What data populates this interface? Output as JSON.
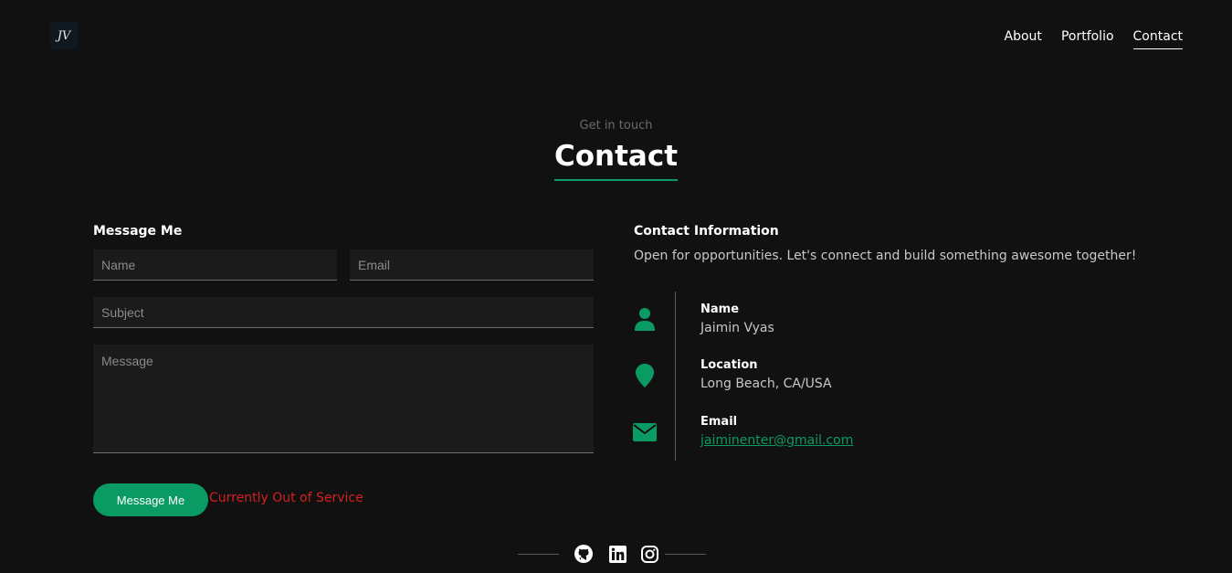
{
  "header": {
    "logo_text": "JV",
    "nav": [
      {
        "label": "About"
      },
      {
        "label": "Portfolio"
      },
      {
        "label": "Contact",
        "active": true
      }
    ]
  },
  "hero": {
    "eyebrow": "Get in touch",
    "title": "Contact"
  },
  "form": {
    "heading": "Message Me",
    "name_placeholder": "Name",
    "email_placeholder": "Email",
    "subject_placeholder": "Subject",
    "message_placeholder": "Message",
    "submit_label": "Message Me",
    "status_text": "Currently Out of Service"
  },
  "info": {
    "heading": "Contact Information",
    "description": "Open for opportunities. Let's connect and build something awesome together!",
    "items": [
      {
        "icon": "user-icon",
        "label": "Name",
        "value": "Jaimin Vyas"
      },
      {
        "icon": "location-pin-icon",
        "label": "Location",
        "value": "Long Beach, CA/USA"
      },
      {
        "icon": "envelope-icon",
        "label": "Email",
        "value": "jaiminenter@gmail.com"
      }
    ]
  },
  "social": [
    {
      "icon": "github-icon"
    },
    {
      "icon": "linkedin-icon"
    },
    {
      "icon": "instagram-icon"
    }
  ],
  "colors": {
    "background": "#111111",
    "accent": "#0a9b64",
    "error": "#d42020",
    "field_bg": "#1b1b1b"
  }
}
